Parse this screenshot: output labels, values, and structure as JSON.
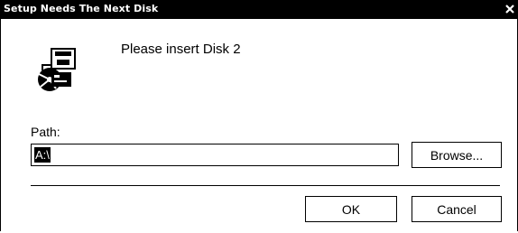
{
  "window": {
    "title": "Setup Needs The Next Disk",
    "close_symbol": "X"
  },
  "icon": {
    "name": "disk-setup-icon"
  },
  "message": "Please insert Disk 2",
  "path": {
    "label": "Path:",
    "value": "A:\\"
  },
  "buttons": {
    "browse": "Browse...",
    "ok": "OK",
    "cancel": "Cancel"
  }
}
